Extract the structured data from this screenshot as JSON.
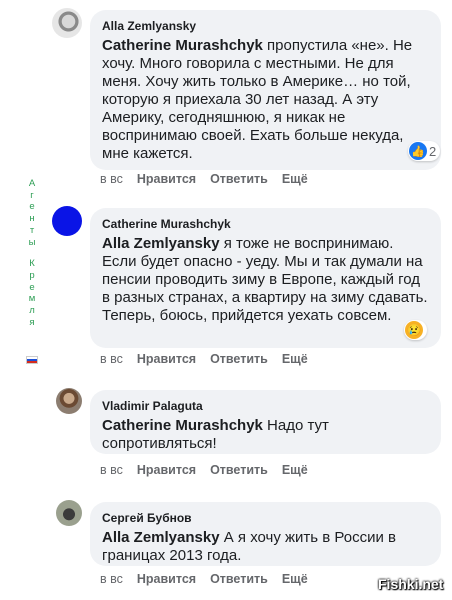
{
  "comments": [
    {
      "author": "Alla Zemlyansky",
      "mention": "Catherine Murashchyk",
      "text": " пропустила «не». Не хочу. Много говорила с местными. Не для меня. Хочу жить только в Америке… но той, которую я приехала 30 лет назад. А эту Америку, сегодняшнюю, я никак не воспринимаю своей. Ехать больше некуда, мне кажется.",
      "reaction_count": "2",
      "reaction_icon": "like-icon"
    },
    {
      "author": "Catherine Murashchyk",
      "mention": "Alla Zemlyansky",
      "text": " я тоже не воспринимаю. Если будет опасно - уеду. Мы и так думали на пенсии проводить зиму в Европе, каждый год в разных странах, а квартиру на зиму сдавать. Теперь, боюсь, прийдется уехать совсем.",
      "reaction_icon": "sad-icon"
    },
    {
      "author": "Vladimir Palaguta",
      "mention": "Catherine Murashchyk",
      "text": " Надо тут сопротивляться!"
    },
    {
      "author": "Сергей Бубнов",
      "mention": "Alla Zemlyansky",
      "text": " А я хочу жить в России в границах 2013 года."
    }
  ],
  "actions": {
    "time": "в вс",
    "like": "Нравится",
    "reply": "Ответить",
    "more": "Ещё"
  },
  "watermark": {
    "word1": [
      "А",
      "г",
      "е",
      "н",
      "т",
      "ы"
    ],
    "word2": [
      "К",
      "р",
      "е",
      "м",
      "л",
      "я"
    ],
    "flag_icon": "russian-flag-icon"
  },
  "site_mark": "Fishki.net",
  "colors": {
    "bubble": "#f0f2f5",
    "action_text": "#65676b",
    "like_blue": "#1877f2",
    "watermark_green": "#2e9e55"
  }
}
